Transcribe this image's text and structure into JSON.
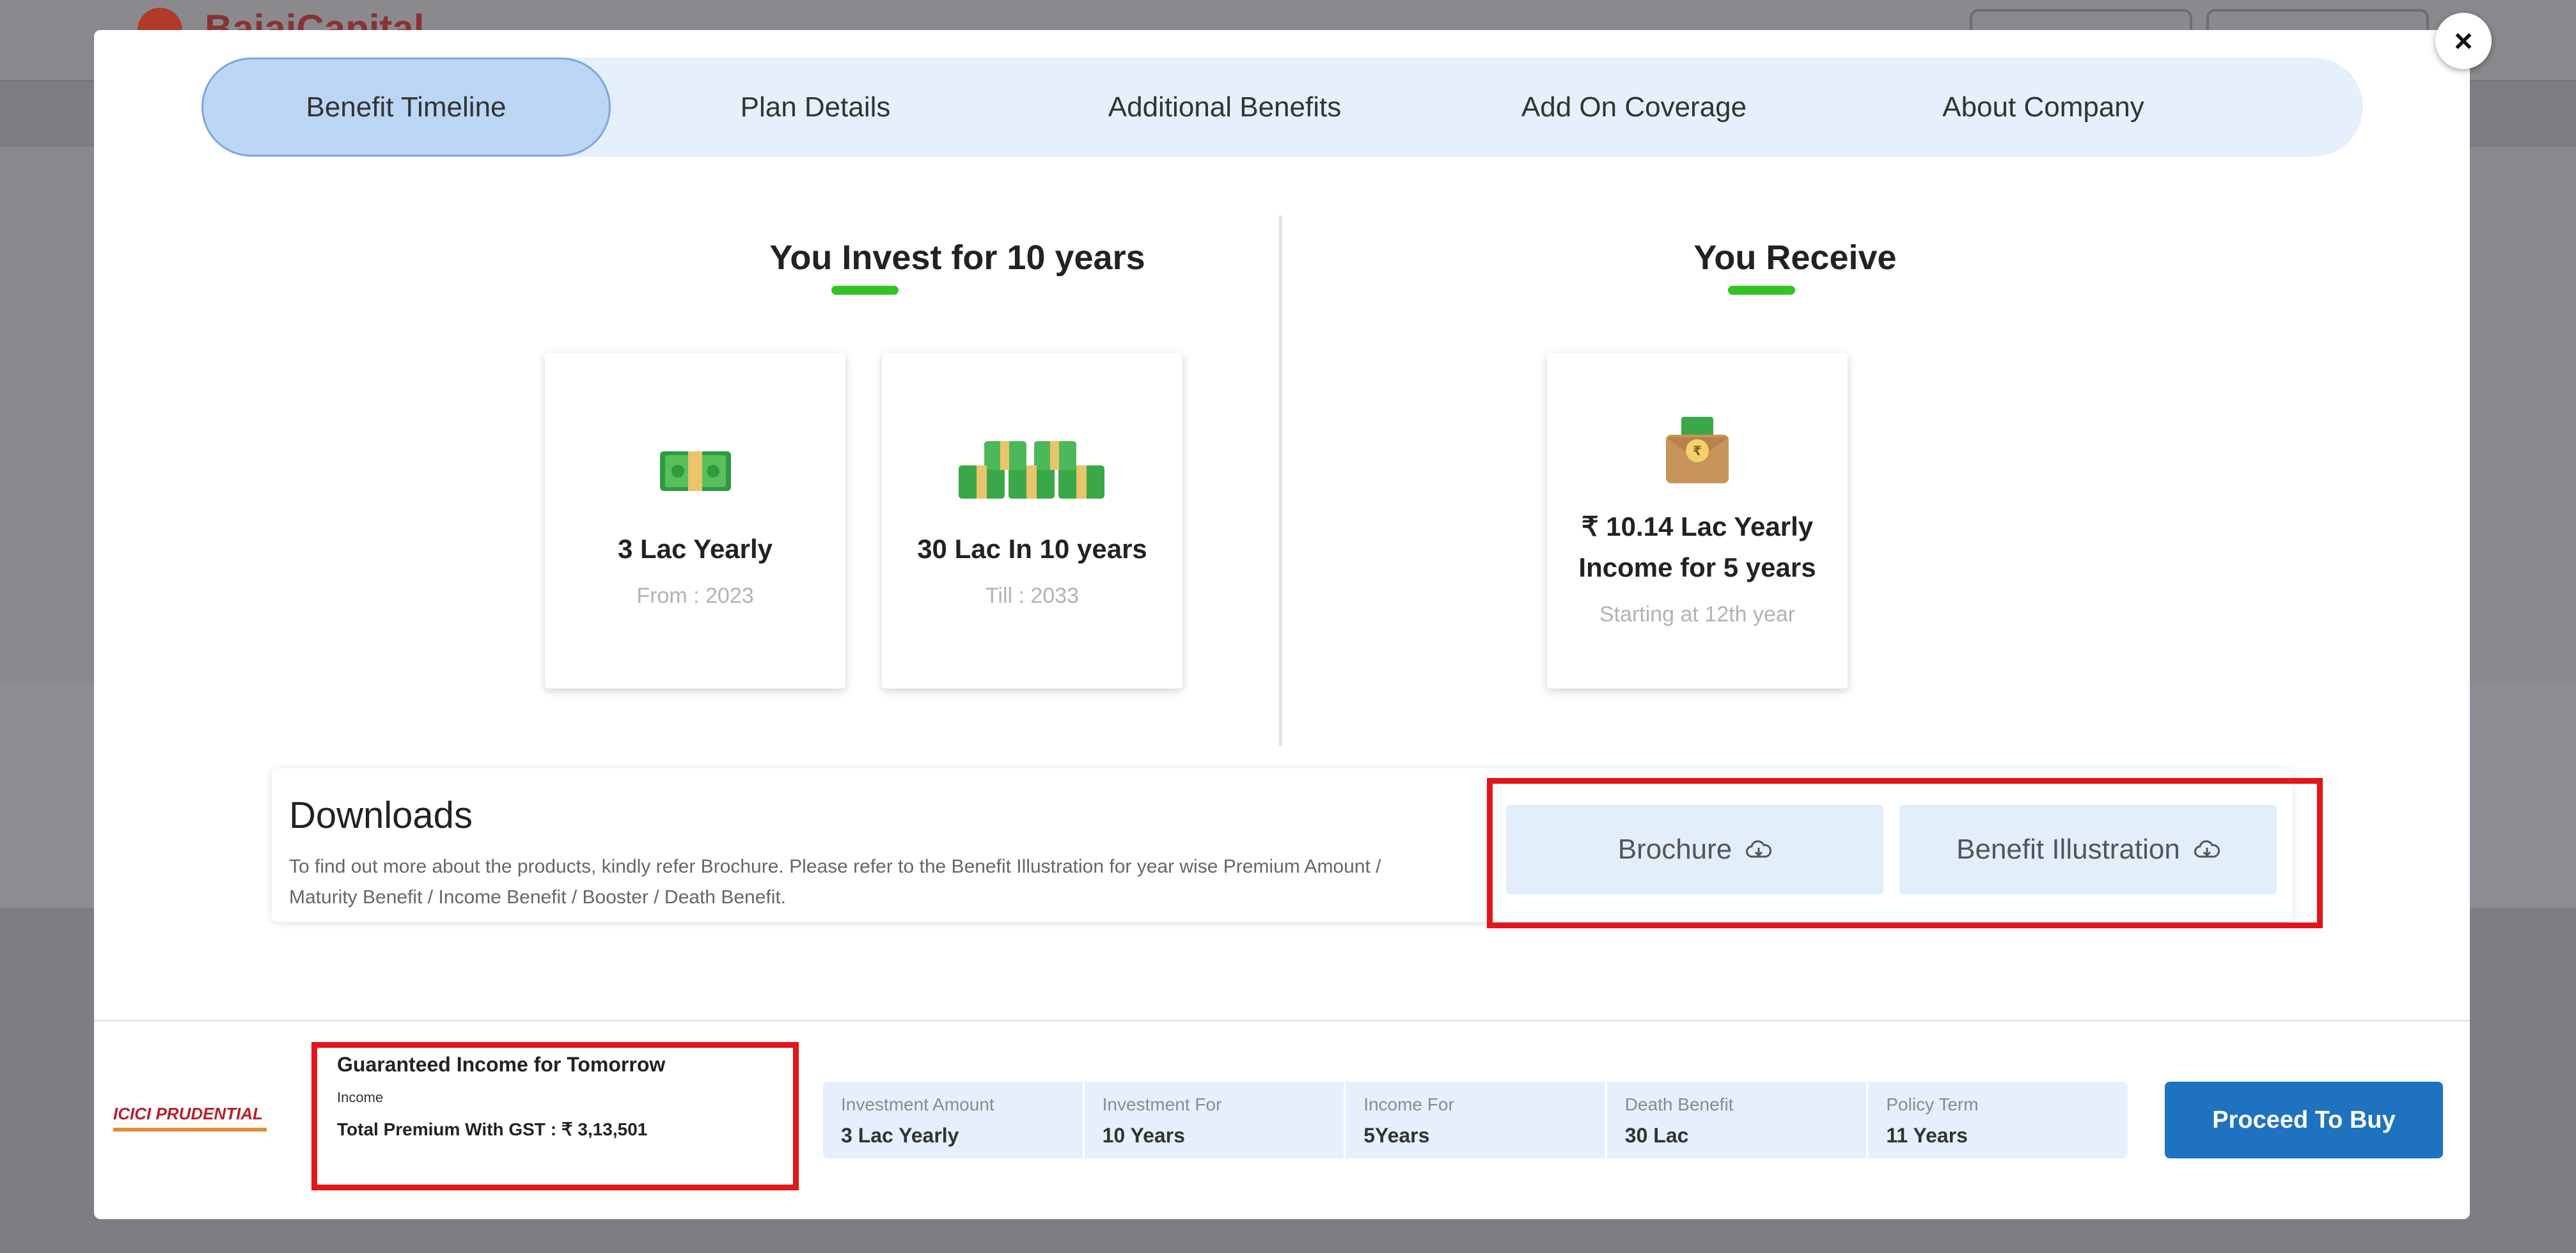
{
  "background": {
    "brand": "BajajCapital"
  },
  "tabs": [
    {
      "label": "Benefit Timeline",
      "active": true
    },
    {
      "label": "Plan Details",
      "active": false
    },
    {
      "label": "Additional Benefits",
      "active": false
    },
    {
      "label": "Add On Coverage",
      "active": false
    },
    {
      "label": "About Company",
      "active": false
    }
  ],
  "invest": {
    "heading": "You Invest for 10 years",
    "cards": [
      {
        "icon": "money-bundle-icon",
        "title": "3 Lac Yearly",
        "sub": "From : 2023"
      },
      {
        "icon": "money-stack-icon",
        "title": "30 Lac In 10 years",
        "sub": "Till : 2033"
      }
    ]
  },
  "receive": {
    "heading": "You Receive",
    "card": {
      "icon": "money-envelope-icon",
      "title_line1": "₹ 10.14 Lac Yearly",
      "title_line2": "Income for 5 years",
      "sub": "Starting at 12th year"
    }
  },
  "downloads": {
    "title": "Downloads",
    "description": "To find out more about the products, kindly refer Brochure. Please refer to the Benefit Illustration for year wise Premium Amount / Maturity Benefit / Income Benefit / Booster / Death Benefit.",
    "brochure_label": "Brochure",
    "illustration_label": "Benefit Illustration"
  },
  "footer": {
    "logo_text": "ICICI PRUDENTIAL",
    "plan_name": "Guaranteed Income for Tomorrow",
    "plan_type": "Income",
    "premium": "Total Premium With GST : ₹ 3,13,501",
    "stats": [
      {
        "label": "Investment Amount",
        "value": "3 Lac Yearly"
      },
      {
        "label": "Investment For",
        "value": "10 Years"
      },
      {
        "label": "Income For",
        "value": "5Years"
      },
      {
        "label": "Death Benefit",
        "value": "30 Lac"
      },
      {
        "label": "Policy Term",
        "value": "11 Years"
      }
    ],
    "proceed_label": "Proceed To Buy"
  },
  "close_glyph": "×",
  "colors": {
    "accent_green": "#31c521",
    "primary_blue": "#1e72c0",
    "highlight_red": "#e3141a",
    "tab_bg": "#e5f0fc"
  }
}
